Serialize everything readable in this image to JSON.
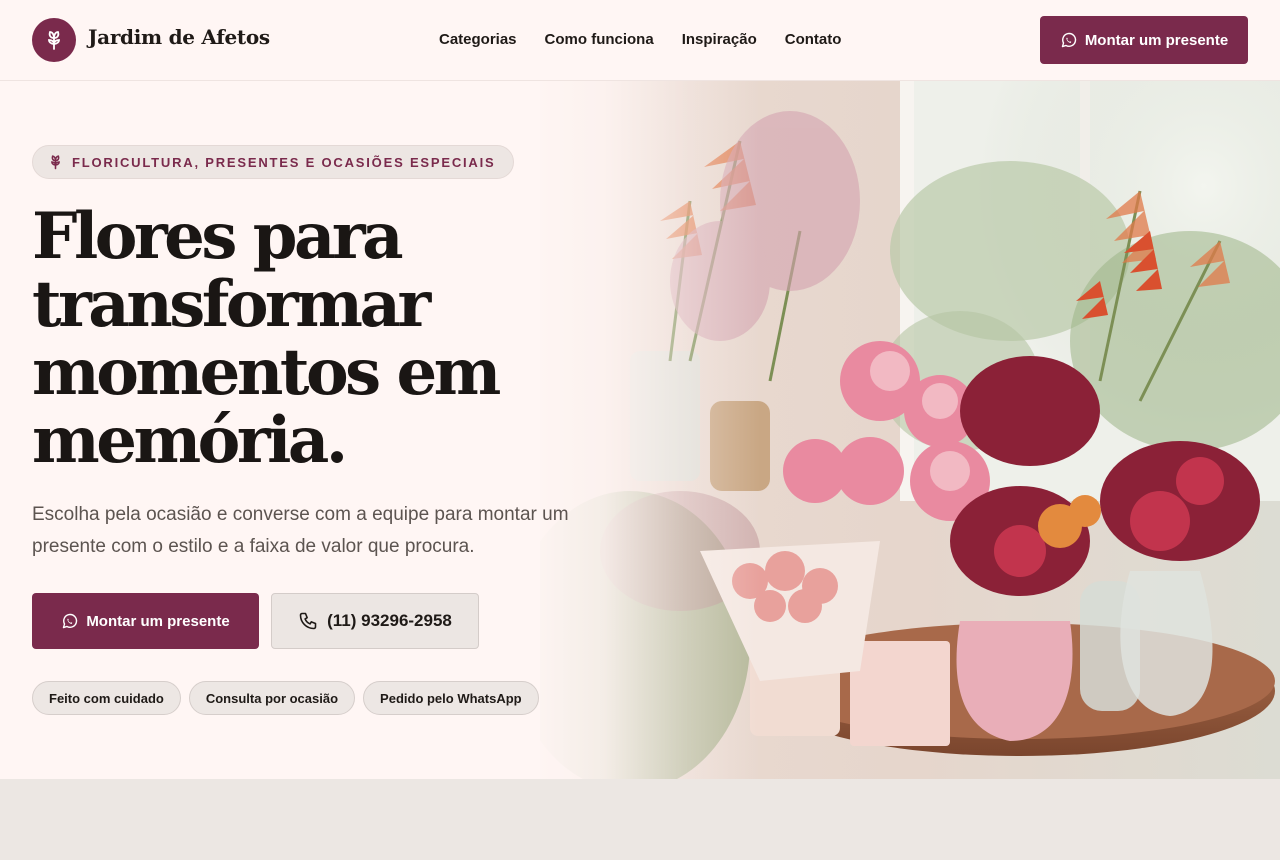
{
  "brand": {
    "name": "Jardim de Afetos",
    "logo_icon": "flower-icon",
    "color_primary": "#7a2a4c",
    "color_background": "#fff6f4"
  },
  "nav": {
    "items": [
      {
        "label": "Categorias"
      },
      {
        "label": "Como funciona"
      },
      {
        "label": "Inspiração"
      },
      {
        "label": "Contato"
      }
    ]
  },
  "header": {
    "cta_label": "Montar um presente",
    "cta_icon": "whatsapp-icon"
  },
  "hero": {
    "eyebrow": "FLORICULTURA, PRESENTES E OCASIÕES ESPECIAIS",
    "eyebrow_icon": "flower-icon",
    "headline_lines": [
      "Flores para",
      "transformar",
      "momentos em",
      "memória."
    ],
    "subtitle_lines": [
      "Escolha pela ocasião e converse com a equipe para montar um",
      "presente com o estilo e a faixa de valor que procura."
    ],
    "primary_cta": "Montar um presente",
    "primary_cta_icon": "whatsapp-icon",
    "phone_cta": "(11) 93296-2958",
    "phone_icon": "phone-icon",
    "chips": [
      {
        "label": "Feito com cuidado"
      },
      {
        "label": "Consulta por ocasião"
      },
      {
        "label": "Pedido pelo WhatsApp"
      }
    ],
    "image_subject": "flower arrangements in vases on a round wooden table"
  }
}
